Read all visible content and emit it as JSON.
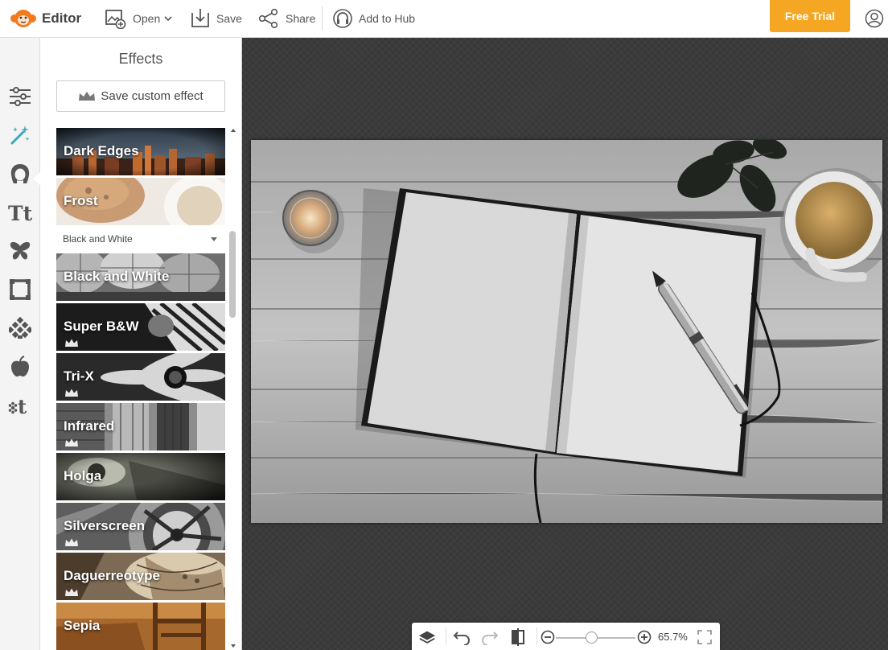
{
  "app": {
    "name": "Editor"
  },
  "toolbar": {
    "open_label": "Open",
    "save_label": "Save",
    "share_label": "Share",
    "hub_label": "Add to Hub",
    "trial_label": "Free Trial"
  },
  "rail": {
    "items": [
      "adjust-icon",
      "effects-wand-icon",
      "retouch-face-icon",
      "text-icon",
      "overlays-butterfly-icon",
      "frames-icon",
      "textures-icon",
      "themes-apple-icon",
      "design-icon"
    ],
    "active": "effects-wand-icon"
  },
  "panel": {
    "title": "Effects",
    "save_custom_label": "Save custom effect",
    "category": "Black and White",
    "effects_top": [
      {
        "name": "Dark Edges",
        "premium": false
      },
      {
        "name": "Frost",
        "premium": false
      }
    ],
    "effects": [
      {
        "name": "Black and White",
        "premium": false
      },
      {
        "name": "Super B&W",
        "premium": true
      },
      {
        "name": "Tri-X",
        "premium": true
      },
      {
        "name": "Infrared",
        "premium": true
      },
      {
        "name": "Holga",
        "premium": false
      },
      {
        "name": "Silverscreen",
        "premium": true
      },
      {
        "name": "Daguerreotype",
        "premium": true
      },
      {
        "name": "Sepia",
        "premium": false
      }
    ]
  },
  "bottombar": {
    "zoom_value": "65.7%",
    "zoom_level": 0.4
  },
  "colors": {
    "accent": "#f5a623",
    "active_tool": "#3aa8c1",
    "canvas_bg": "#3b3b3b"
  }
}
